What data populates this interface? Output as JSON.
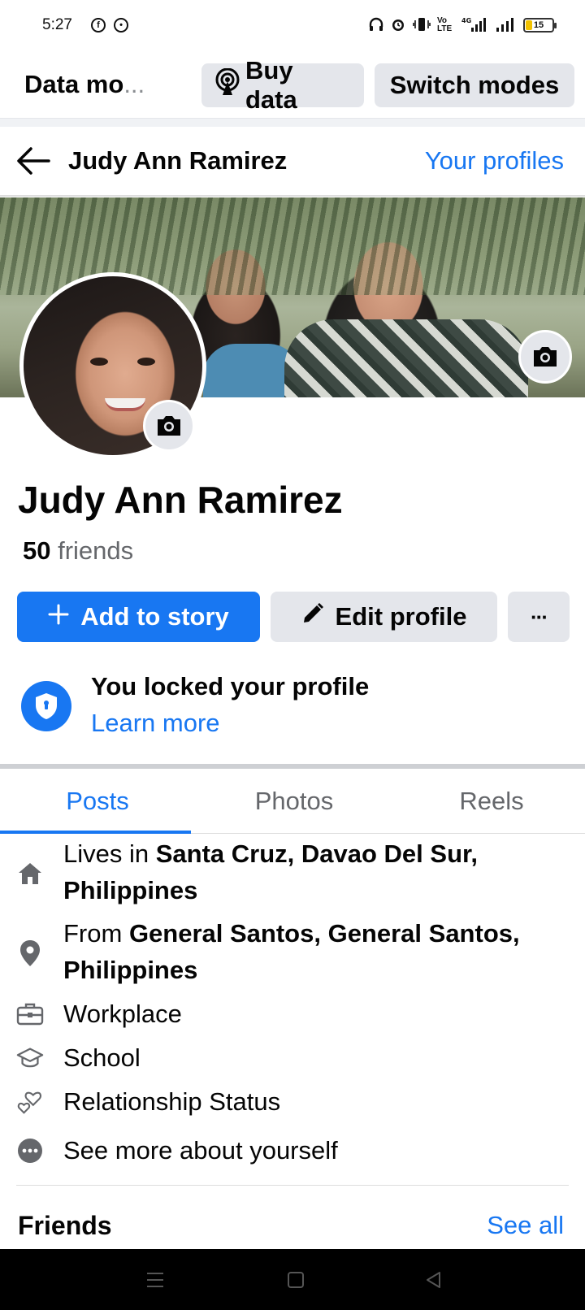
{
  "status_bar": {
    "time": "5:27",
    "battery": "15",
    "network": "4G",
    "volte": "Vo LTE"
  },
  "data_bar": {
    "title": "Data mo",
    "ellipsis": "...",
    "buy_data_label": "Buy data",
    "switch_modes_label": "Switch modes"
  },
  "profile_header": {
    "name": "Judy Ann Ramirez",
    "your_profiles": "Your profiles"
  },
  "profile": {
    "name": "Judy Ann Ramirez",
    "friend_count": "50",
    "friends_word": "friends"
  },
  "actions": {
    "add_to_story": "Add to story",
    "edit_profile": "Edit profile",
    "more": "···"
  },
  "lock": {
    "title": "You locked your profile",
    "learn_more": "Learn more"
  },
  "tabs": [
    "Posts",
    "Photos",
    "Reels"
  ],
  "details": {
    "lives_prefix": "Lives in ",
    "lives_place": "Santa Cruz, Davao Del Sur, Philippines",
    "from_prefix": "From ",
    "from_place": "General Santos, General Santos, Philippines",
    "workplace": "Workplace",
    "school": "School",
    "relationship": "Relationship Status",
    "see_more": "See more about yourself"
  },
  "friends_section": {
    "title": "Friends",
    "see_all": "See all"
  },
  "colors": {
    "accent": "#1877f2",
    "button_grey": "#e4e6eb",
    "secondary_text": "#65676b"
  }
}
